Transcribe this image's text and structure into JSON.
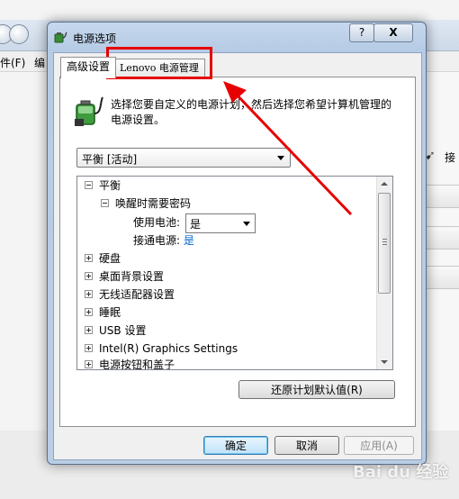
{
  "background": {
    "menu_items": [
      "件(F)",
      "编"
    ],
    "right_text": "接"
  },
  "dialog": {
    "title": "电源选项",
    "help_label": "?",
    "close_label": "X",
    "tabs": [
      {
        "label": "高级设置",
        "active": true
      },
      {
        "label": "Lenovo 电源管理",
        "active": false
      }
    ],
    "description": "选择您要自定义的电源计划，然后选择您希望计算机管理的电源设置。",
    "plan_dropdown": {
      "selected": "平衡 [活动]"
    },
    "tree": {
      "root": "平衡",
      "password_group": "唤醒时需要密码",
      "battery_label": "使用电池:",
      "battery_value": "是",
      "plugged_label": "接通电源:",
      "plugged_value": "是",
      "items": [
        "硬盘",
        "桌面背景设置",
        "无线适配器设置",
        "睡眠",
        "USB 设置",
        "Intel(R) Graphics Settings",
        "电源按钮和盖子"
      ]
    },
    "buttons": {
      "restore": "还原计划默认值(R)",
      "ok": "确定",
      "cancel": "取消",
      "apply": "应用(A)"
    }
  },
  "annotation": {
    "color": "#e60000"
  },
  "watermark": "Bai du 经验",
  "colors": {
    "accent": "#3c7fb1",
    "link": "#0066cc"
  }
}
